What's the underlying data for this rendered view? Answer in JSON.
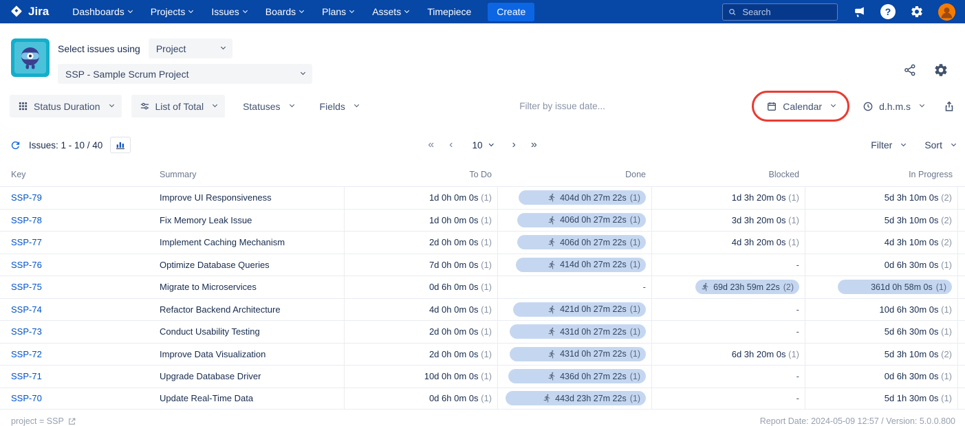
{
  "colors": {
    "navbar_bg": "#0747A6",
    "create_btn": "#0C66E4",
    "link_blue": "#0052CC",
    "bar_fill": "#C5D7F0",
    "annotation_red": "#E93B32",
    "text_dark": "#172B4D",
    "text_grey": "#6B778C"
  },
  "icons": {
    "jira-logo": "diamond-gem",
    "search": "magnifier",
    "megaphone": "announcement",
    "help": "question-circle",
    "gear": "settings",
    "avatar": "user",
    "app-logo": "timepiece-character",
    "share": "share-nodes",
    "grid": "grid-3x3",
    "sliders": "adjust-sliders",
    "calendar": "calendar",
    "clock": "clock",
    "export": "export-arrow",
    "refresh": "sync",
    "chart": "bar-chart",
    "runner": "sprint-runner",
    "external-link": "open-in-new"
  },
  "navbar": {
    "brand": "Jira",
    "items": [
      {
        "label": "Dashboards",
        "caret": true
      },
      {
        "label": "Projects",
        "caret": true
      },
      {
        "label": "Issues",
        "caret": true
      },
      {
        "label": "Boards",
        "caret": true
      },
      {
        "label": "Plans",
        "caret": true
      },
      {
        "label": "Assets",
        "caret": true
      },
      {
        "label": "Timepiece",
        "caret": false
      }
    ],
    "create_label": "Create",
    "search_placeholder": "Search"
  },
  "header": {
    "select_label": "Select issues using",
    "scope_dropdown": "Project",
    "project_dropdown": "SSP - Sample Scrum Project"
  },
  "toolbar": {
    "report_type": "Status Duration",
    "aggregation": "List of Total",
    "statuses": "Statuses",
    "fields": "Fields",
    "date_filter_placeholder": "Filter by issue date...",
    "calendar_label": "Calendar",
    "format_label": "d.h.m.s"
  },
  "pagination": {
    "issues_label": "Issues: 1 - 10 / 40",
    "page_size": "10",
    "filter_label": "Filter",
    "sort_label": "Sort"
  },
  "table": {
    "columns": [
      "Key",
      "Summary",
      "To Do",
      "Done",
      "Blocked",
      "In Progress"
    ],
    "rows": [
      {
        "key": "SSP-79",
        "summary": "Improve UI Responsiveness",
        "todo": {
          "t": "1d 0h 0m 0s",
          "c": "(1)"
        },
        "done": {
          "t": "404d 0h 27m 22s",
          "c": "(1)",
          "bar": true,
          "pct": 86,
          "icon": true
        },
        "blocked": {
          "t": "1d 3h 20m 0s",
          "c": "(1)"
        },
        "inprogress": {
          "t": "5d 3h 10m 0s",
          "c": "(2)"
        }
      },
      {
        "key": "SSP-78",
        "summary": "Fix Memory Leak Issue",
        "todo": {
          "t": "1d 0h 0m 0s",
          "c": "(1)"
        },
        "done": {
          "t": "406d 0h 27m 22s",
          "c": "(1)",
          "bar": true,
          "pct": 87,
          "icon": true
        },
        "blocked": {
          "t": "3d 3h 20m 0s",
          "c": "(1)"
        },
        "inprogress": {
          "t": "5d 3h 10m 0s",
          "c": "(2)"
        }
      },
      {
        "key": "SSP-77",
        "summary": "Implement Caching Mechanism",
        "todo": {
          "t": "2d 0h 0m 0s",
          "c": "(1)"
        },
        "done": {
          "t": "406d 0h 27m 22s",
          "c": "(1)",
          "bar": true,
          "pct": 87,
          "icon": true
        },
        "blocked": {
          "t": "4d 3h 20m 0s",
          "c": "(1)"
        },
        "inprogress": {
          "t": "4d 3h 10m 0s",
          "c": "(2)"
        }
      },
      {
        "key": "SSP-76",
        "summary": "Optimize Database Queries",
        "todo": {
          "t": "7d 0h 0m 0s",
          "c": "(1)"
        },
        "done": {
          "t": "414d 0h 27m 22s",
          "c": "(1)",
          "bar": true,
          "pct": 88,
          "icon": true
        },
        "blocked": {
          "t": "-"
        },
        "inprogress": {
          "t": "0d 6h 30m 0s",
          "c": "(1)"
        }
      },
      {
        "key": "SSP-75",
        "summary": "Migrate to Microservices",
        "todo": {
          "t": "0d 6h 0m 0s",
          "c": "(1)"
        },
        "done": {
          "t": "-"
        },
        "blocked": {
          "t": "69d 23h 59m 22s",
          "c": "(2)",
          "bar": true,
          "pct": 56,
          "icon": true
        },
        "inprogress": {
          "t": "361d 0h 58m 0s",
          "c": "(1)",
          "bar": true,
          "pct": 78,
          "icon": false
        }
      },
      {
        "key": "SSP-74",
        "summary": "Refactor Backend Architecture",
        "todo": {
          "t": "4d 0h 0m 0s",
          "c": "(1)"
        },
        "done": {
          "t": "421d 0h 27m 22s",
          "c": "(1)",
          "bar": true,
          "pct": 90,
          "icon": true
        },
        "blocked": {
          "t": "-"
        },
        "inprogress": {
          "t": "10d 6h 30m 0s",
          "c": "(1)"
        }
      },
      {
        "key": "SSP-73",
        "summary": "Conduct Usability Testing",
        "todo": {
          "t": "2d 0h 0m 0s",
          "c": "(1)"
        },
        "done": {
          "t": "431d 0h 27m 22s",
          "c": "(1)",
          "bar": true,
          "pct": 92,
          "icon": true
        },
        "blocked": {
          "t": "-"
        },
        "inprogress": {
          "t": "5d 6h 30m 0s",
          "c": "(1)"
        }
      },
      {
        "key": "SSP-72",
        "summary": "Improve Data Visualization",
        "todo": {
          "t": "2d 0h 0m 0s",
          "c": "(1)"
        },
        "done": {
          "t": "431d 0h 27m 22s",
          "c": "(1)",
          "bar": true,
          "pct": 92,
          "icon": true
        },
        "blocked": {
          "t": "6d 3h 20m 0s",
          "c": "(1)"
        },
        "inprogress": {
          "t": "5d 3h 10m 0s",
          "c": "(2)"
        }
      },
      {
        "key": "SSP-71",
        "summary": "Upgrade Database Driver",
        "todo": {
          "t": "10d 0h 0m 0s",
          "c": "(1)"
        },
        "done": {
          "t": "436d 0h 27m 22s",
          "c": "(1)",
          "bar": true,
          "pct": 93,
          "icon": true
        },
        "blocked": {
          "t": "-"
        },
        "inprogress": {
          "t": "0d 6h 30m 0s",
          "c": "(1)"
        }
      },
      {
        "key": "SSP-70",
        "summary": "Update Real-Time Data",
        "todo": {
          "t": "0d 6h 0m 0s",
          "c": "(1)"
        },
        "done": {
          "t": "443d 23h 27m 22s",
          "c": "(1)",
          "bar": true,
          "pct": 95,
          "icon": true
        },
        "blocked": {
          "t": "-"
        },
        "inprogress": {
          "t": "5d 1h 30m 0s",
          "c": "(1)"
        }
      }
    ]
  },
  "footer": {
    "left": "project = SSP",
    "right": "Report Date: 2024-05-09 12:57 / Version: 5.0.0.800"
  }
}
